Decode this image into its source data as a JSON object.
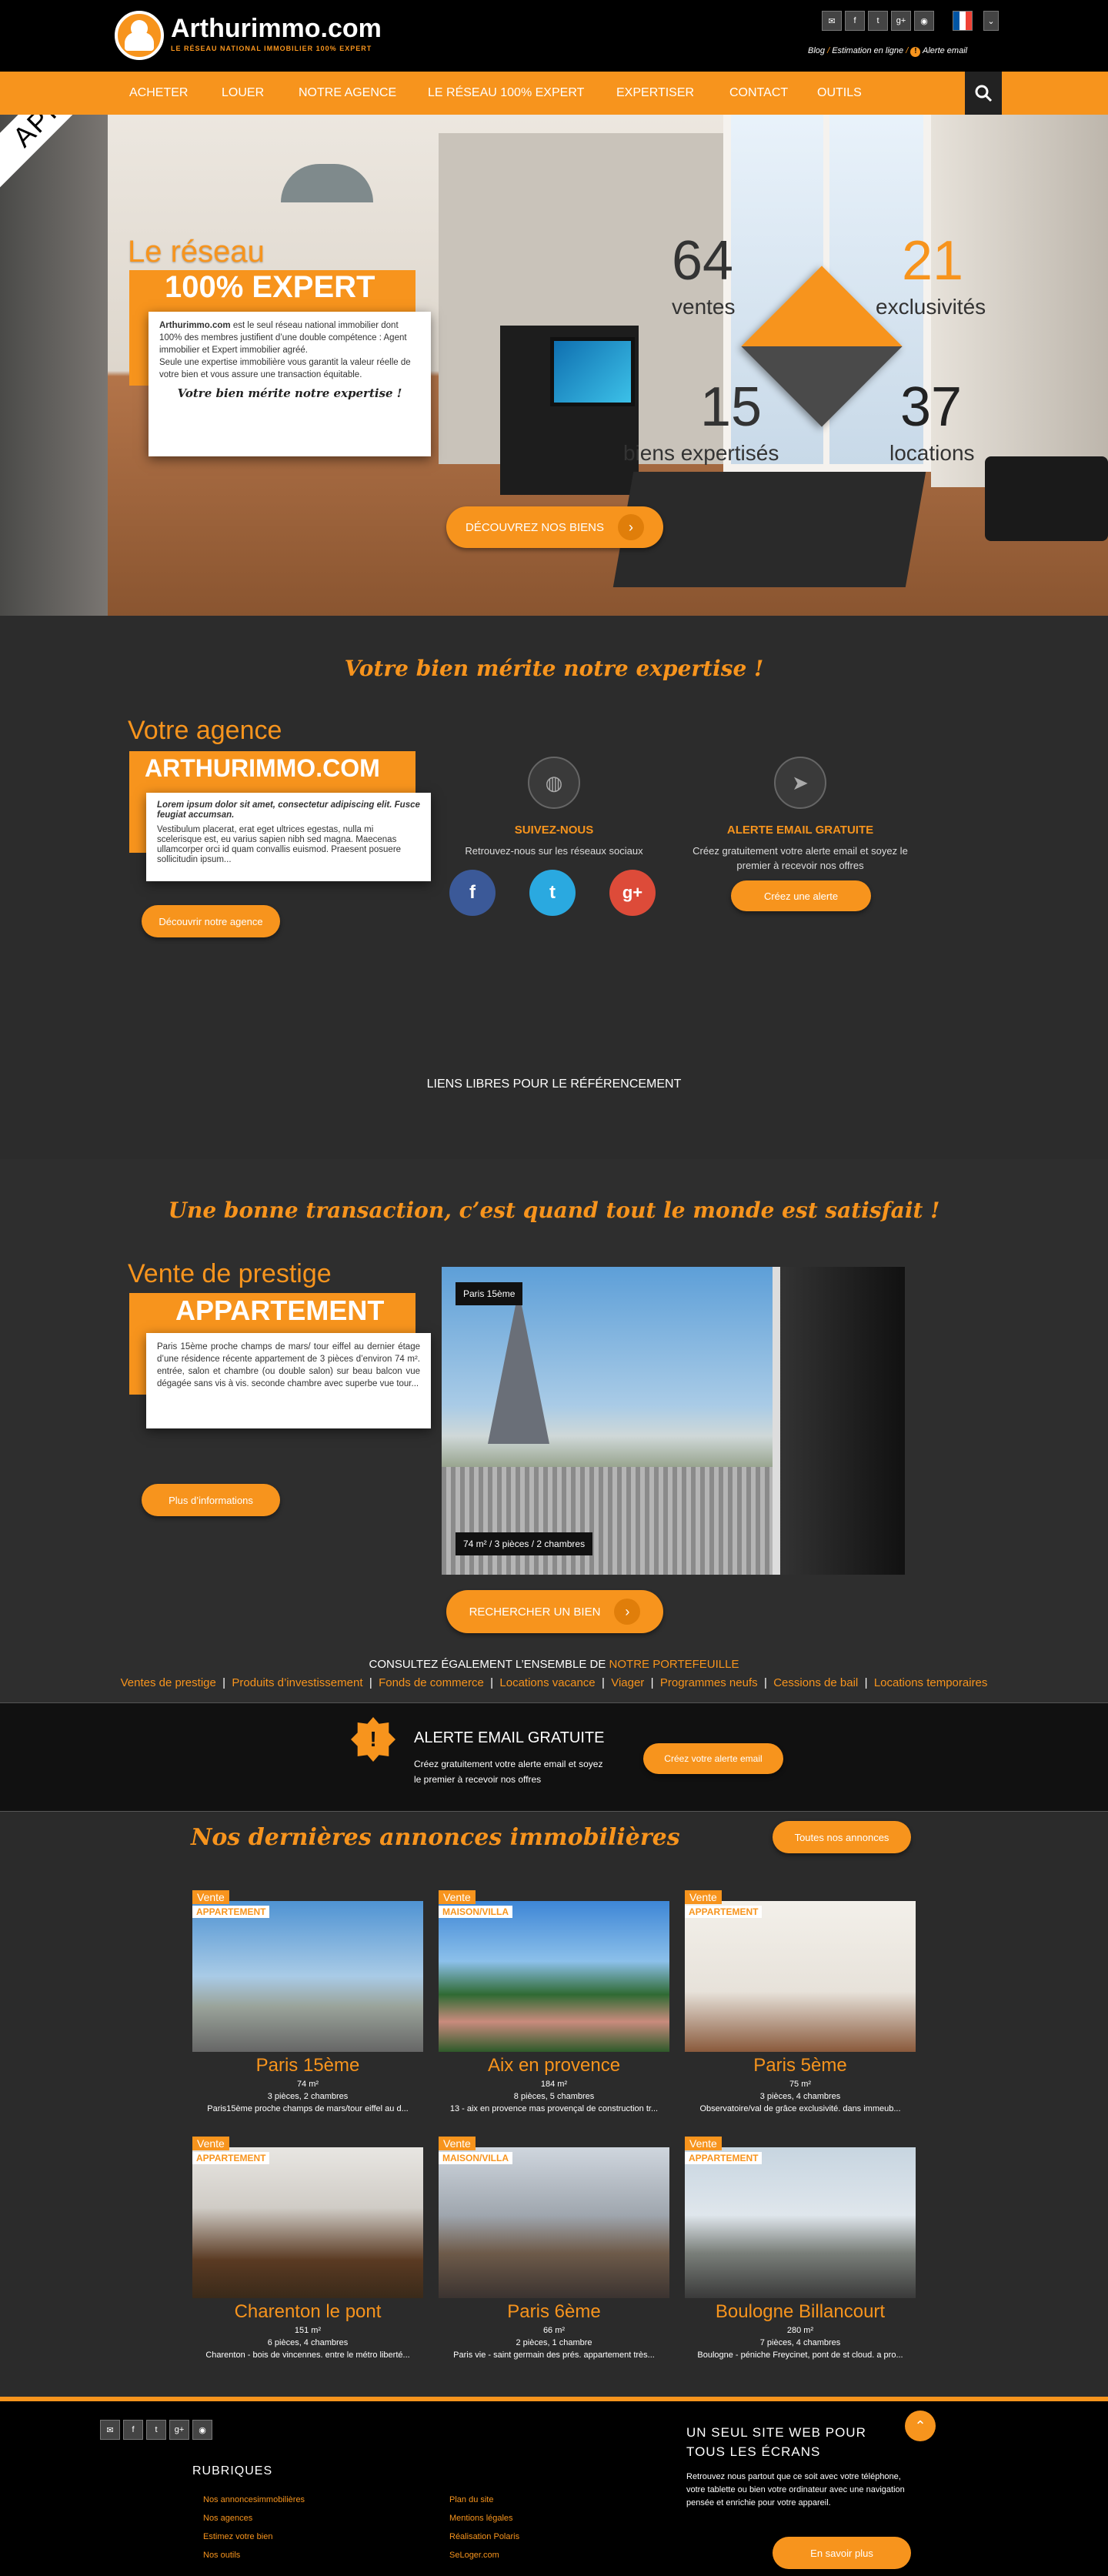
{
  "header": {
    "logo_text": "Arthurimmo.com",
    "logo_tagline": "LE RÉSEAU NATIONAL IMMOBILIER 100% EXPERT",
    "social_icons": [
      "email-icon",
      "facebook-icon",
      "twitter-icon",
      "googleplus-icon",
      "rss-icon",
      "french-flag-icon",
      "chevron-down-icon"
    ],
    "links": {
      "blog": "Blog",
      "estimation": "Estimation en ligne",
      "alerte": "Alerte email"
    }
  },
  "nav": {
    "items": [
      "ACHETER",
      "LOUER",
      "NOTRE AGENCE",
      "LE RÉSEAU 100% EXPERT",
      "EXPERTISER",
      "CONTACT",
      "OUTILS"
    ]
  },
  "hero": {
    "ribbon": "APRES",
    "title_small": "Le réseau",
    "title_big": "100% EXPERT",
    "body_brand": "Arthurimmo.com",
    "body_text": " est le seul réseau national immobilier dont 100% des membres justifient d’une double compétence : Agent immobilier et Expert immobilier agréé.",
    "body_text2": "Seule une expertise immobilière vous garantit la valeur réelle de votre bien et vous assure une transaction équitable.",
    "slogan": "Votre bien mérite notre expertise !",
    "stats": [
      {
        "value": "64",
        "label": "ventes"
      },
      {
        "value": "21",
        "label": "exclusivités"
      },
      {
        "value": "15",
        "label": "biens expertisés"
      },
      {
        "value": "37",
        "label": "locations"
      }
    ],
    "cta": "DÉCOUVREZ NOS BIENS"
  },
  "agency": {
    "tagline": "Votre bien mérite notre expertise !",
    "title_small": "Votre agence",
    "title_big": "ARTHURIMMO.COM",
    "lead": "Lorem ipsum dolor sit amet, consectetur adipiscing elit. Fusce feugiat accumsan.",
    "text": "Vestibulum placerat, erat eget ultrices egestas, nulla mi scelerisque est, eu varius sapien nibh sed magna. Maecenas ullamcorper orci id quam convallis euismod. Praesent posuere sollicitudin ipsum...",
    "button": "Découvrir notre agence",
    "follow_title": "SUIVEZ-NOUS",
    "follow_text": "Retrouvez-nous sur les réseaux sociaux",
    "alert_title": "ALERTE EMAIL GRATUITE",
    "alert_text": "Créez gratuitement votre alerte email et soyez le premier à recevoir nos offres",
    "alert_button": "Créez une alerte",
    "seo_title": "LIENS LIBRES POUR LE RÉFÉRENCEMENT"
  },
  "prestige": {
    "tagline": "Une bonne transaction, c’est quand tout le monde est satisfait !",
    "title_small": "Vente de prestige",
    "title_big": "APPARTEMENT",
    "text": "Paris 15ème proche champs de mars/ tour eiffel au dernier étage d’une résidence récente appartement de 3 pièces d’environ 74 m². entrée, salon et chambre (ou double salon) sur beau balcon vue dégagée sans vis à vis. seconde chambre avec superbe vue tour...",
    "button": "Plus d’informations",
    "photo_tag": "Paris 15ème",
    "photo_caption": "74 m² / 3 pièces / 2 chambres",
    "search_button": "RECHERCHER UN BIEN",
    "portfolio_prefix": "CONSULTEZ ÉGALEMENT L’ENSEMBLE DE ",
    "portfolio_link": "NOTRE PORTEFEUILLE",
    "links": [
      "Ventes de prestige",
      "Produits d’investissement",
      "Fonds de commerce",
      "Locations vacance",
      "Viager",
      "Programmes neufs",
      "Cessions de bail",
      "Locations temporaires"
    ]
  },
  "alert_band": {
    "title": "ALERTE EMAIL GRATUITE",
    "text1": "Créez gratuitement votre alerte email et soyez",
    "text2": "le premier à recevoir nos offres",
    "button": "Créez votre alerte email"
  },
  "listings": {
    "title": "Nos dernières annonces immobilières",
    "all_button": "Toutes nos annonces",
    "items": [
      {
        "vente": "Vente",
        "type": "APPARTEMENT",
        "city": "Paris 15ème",
        "area": "74 m²",
        "rooms": "3 pièces, 2 chambres",
        "desc": "Paris15ème proche champs de mars/tour eiffel au d..."
      },
      {
        "vente": "Vente",
        "type": "MAISON/VILLA",
        "city": "Aix en provence",
        "area": "184 m²",
        "rooms": "8 pièces, 5 chambres",
        "desc": "13 - aix en provence mas provençal de construction tr..."
      },
      {
        "vente": "Vente",
        "type": "APPARTEMENT",
        "city": "Paris 5ème",
        "area": "75 m²",
        "rooms": "3 pièces, 4 chambres",
        "desc": "Observatoire/val de grâce exclusivité. dans immeub..."
      },
      {
        "vente": "Vente",
        "type": "APPARTEMENT",
        "city": "Charenton le pont",
        "area": "151 m²",
        "rooms": "6 pièces, 4 chambres",
        "desc": "Charenton - bois de vincennes. entre le métro liberté..."
      },
      {
        "vente": "Vente",
        "type": "MAISON/VILLA",
        "city": "Paris 6ème",
        "area": "66 m²",
        "rooms": "2 pièces, 1 chambre",
        "desc": "Paris vie - saint germain des prés. appartement très..."
      },
      {
        "vente": "Vente",
        "type": "APPARTEMENT",
        "city": "Boulogne Billancourt",
        "area": "280 m²",
        "rooms": "7 pièces, 4 chambres",
        "desc": "Boulogne - péniche Freycinet, pont de st cloud. a pro..."
      }
    ]
  },
  "footer": {
    "rubriques_title": "RUBRIQUES",
    "col1": [
      "Nos annoncesimmobilières",
      "Nos agences",
      "Estimez votre bien",
      "Nos outils"
    ],
    "col2": [
      "Plan du site",
      "Mentions légales",
      "Réalisation Polaris",
      "SeLoger.com"
    ],
    "promo_title": "UN SEUL SITE WEB POUR TOUS LES ÉCRANS",
    "promo_text": "Retrouvez nous partout que ce soit avec votre téléphone, votre tablette ou bien votre ordinateur avec une navigation pensée et enrichie pour votre appareil.",
    "promo_button": "En savoir plus",
    "icons": [
      "email-icon",
      "facebook-icon",
      "twitter-icon",
      "googleplus-icon",
      "rss-icon"
    ]
  }
}
